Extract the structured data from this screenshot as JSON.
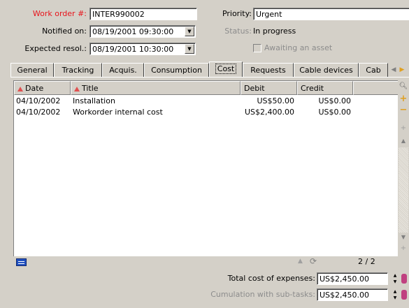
{
  "form": {
    "work_order_label": "Work order #:",
    "work_order_value": "INTER990002",
    "notified_label": "Notified on:",
    "notified_value": "08/19/2001 09:30:00",
    "expected_label": "Expected resol.:",
    "expected_value": "08/19/2001 10:30:00",
    "priority_label": "Priority:",
    "priority_value": "Urgent",
    "status_label": "Status:",
    "status_value": "In progress",
    "awaiting_label": "Awaiting an asset",
    "awaiting_checked": false
  },
  "tabs": [
    {
      "label": "General"
    },
    {
      "label": "Tracking"
    },
    {
      "label": "Acquis."
    },
    {
      "label": "Consumption"
    },
    {
      "label": "Cost"
    },
    {
      "label": "Requests"
    },
    {
      "label": "Cable devices"
    },
    {
      "label": "Cab"
    }
  ],
  "active_tab": "Cost",
  "table": {
    "columns": {
      "date": "Date",
      "title": "Title",
      "debit": "Debit",
      "credit": "Credit"
    },
    "rows": [
      {
        "date": "04/10/2002",
        "title": "Installation",
        "debit": "US$50.00",
        "credit": "US$0.00"
      },
      {
        "date": "04/10/2002",
        "title": "Workorder internal cost",
        "debit": "US$2,400.00",
        "credit": "US$0.00"
      }
    ]
  },
  "status": {
    "record_count": "2 / 2"
  },
  "totals": {
    "total_label": "Total cost of expenses:",
    "total_value": "US$2,450.00",
    "cumulation_label": "Cumulation with sub-tasks:",
    "cumulation_value": "US$2,450.00"
  },
  "colors": {
    "required_label": "#e8141c",
    "disabled_label": "#8c8c8c",
    "sort_indicator": "#e05050",
    "add_button": "#e0a020"
  }
}
